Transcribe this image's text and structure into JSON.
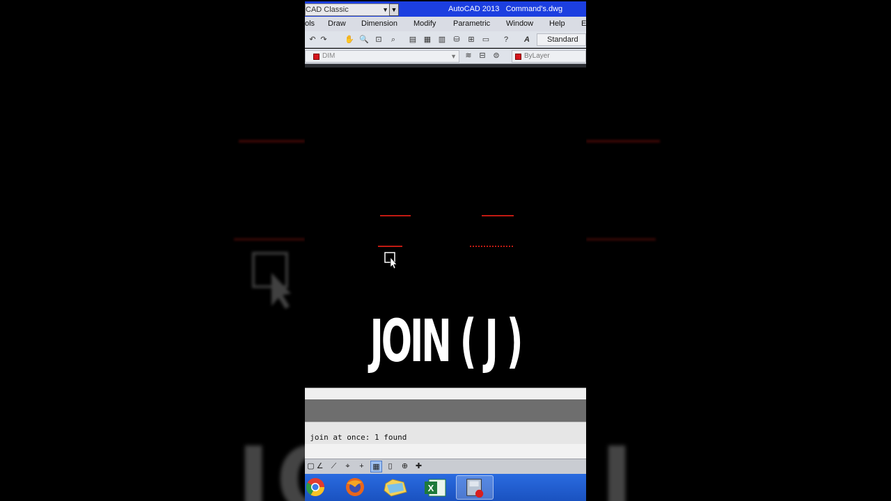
{
  "titlebar": {
    "workspace": "CAD Classic",
    "app": "AutoCAD 2013",
    "file": "Command's.dwg"
  },
  "menubar": {
    "items": [
      "ols",
      "Draw",
      "Dimension",
      "Modify",
      "Parametric",
      "Window",
      "Help",
      "E"
    ]
  },
  "toolbar": {
    "text_style": "Standard"
  },
  "layers": {
    "current_layer": "DIM",
    "color": "ByLayer",
    "layer_color": "#d6141c"
  },
  "overlay": {
    "title": "JOIN ( J )"
  },
  "command": {
    "output": "o join at once: 1 found"
  },
  "colors": {
    "titlebar": "#1c3fe0",
    "line_red": "#c21a12",
    "taskbar": "#1a52c0"
  },
  "taskbar": {
    "apps": [
      "chrome-icon",
      "firefox-icon",
      "folder-icon",
      "excel-icon",
      "autocad-icon"
    ]
  }
}
